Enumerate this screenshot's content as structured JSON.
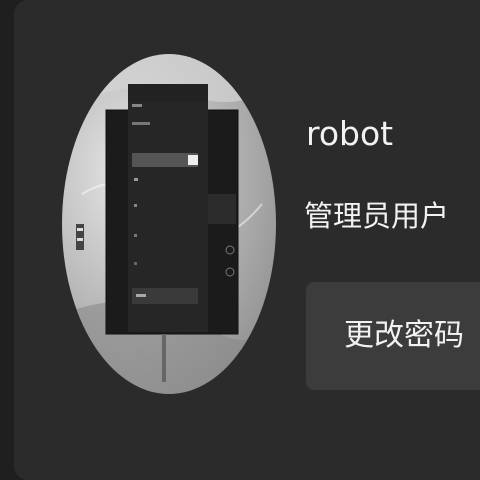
{
  "profile": {
    "username": "robot",
    "role": "管理员用户",
    "change_password_label": "更改密码",
    "avatar_icon": "user-avatar-image"
  },
  "colors": {
    "background": "#1f1f1f",
    "panel": "#2b2b2b",
    "button": "#3c3c3c",
    "text": "#f2f2f2"
  }
}
